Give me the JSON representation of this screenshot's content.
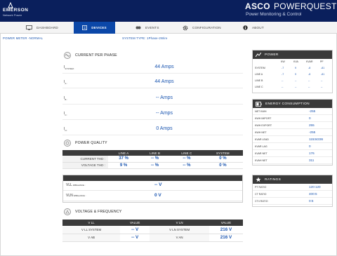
{
  "header": {
    "logo": "EMERSON",
    "logo_sub": "Network Power",
    "brand_a": "ASCO",
    "brand_b": "POWERQUEST",
    "brand_sub": "Power Monitoring & Control"
  },
  "nav": {
    "items": [
      {
        "label": "DASHBOARD",
        "icon": "monitor-icon"
      },
      {
        "label": "DEVICES",
        "icon": "device-icon"
      },
      {
        "label": "EVENTS",
        "icon": "events-icon"
      },
      {
        "label": "CONFIGURATION",
        "icon": "gear-icon"
      },
      {
        "label": "ABOUT",
        "icon": "info-icon"
      }
    ]
  },
  "status": {
    "meter": "POWER METER -NORMAL",
    "system_type": "SYSTEM TYPE: 1Phase-2Wire"
  },
  "current_per_phase": {
    "title": "CURRENT PER PHASE",
    "rows": [
      {
        "label": "I",
        "sub": "SYSTEM :",
        "value": "44 Amps"
      },
      {
        "label": "I",
        "sub": "A :",
        "value": "44 Amps"
      },
      {
        "label": "I",
        "sub": "B :",
        "value": "-- Amps"
      },
      {
        "label": "I",
        "sub": "C :",
        "value": "-- Amps"
      },
      {
        "label": "I",
        "sub": "N :",
        "value": "0 Amps"
      }
    ]
  },
  "power_quality": {
    "title": "POWER QUALITY",
    "columns": [
      "",
      "LINE A",
      "LINE B",
      "LINE C",
      "SYSTEM"
    ],
    "rows": [
      {
        "label": "CURRENT THD :",
        "a": "37 %",
        "b": "-- %",
        "c": "-- %",
        "sys": "0 %"
      },
      {
        "label": "VOLTAGE THD :",
        "a": "9 %",
        "b": "-- %",
        "c": "-- %",
        "sys": "0 %"
      }
    ]
  },
  "imbalance": {
    "rows": [
      {
        "label": "VLL",
        "sub": "IMBALANCE :",
        "value": "-- V"
      },
      {
        "label": "VLN",
        "sub": "IMBALANCE :",
        "value": "0 V"
      }
    ]
  },
  "voltage_frequency": {
    "title": "VOLTAGE & FREQUENCY",
    "columns": [
      "V LL",
      "VALUE",
      "V LN",
      "VALUE"
    ],
    "rows": [
      {
        "ll": "V LL SYSTEM",
        "llv": "-- V",
        "ln": "V LN SYSTEM",
        "lnv": "216 V"
      },
      {
        "ll": "V AB",
        "llv": "-- V",
        "ln": "V AN",
        "lnv": "216 V"
      }
    ]
  },
  "power": {
    "title": "POWER",
    "columns": [
      "KW",
      "KVA",
      "KVAR",
      "PF"
    ],
    "rows": [
      {
        "label": "SYSTEM",
        "kw": "-7",
        "kva": "9",
        "kvar": "-8",
        "pf": "-81"
      },
      {
        "label": "LINE A",
        "kw": "-7",
        "kva": "9",
        "kvar": "-8",
        "pf": "-81"
      },
      {
        "label": "LINE B",
        "kw": "--",
        "kva": "--",
        "kvar": "--",
        "pf": "--"
      },
      {
        "label": "LINE C",
        "kw": "--",
        "kva": "--",
        "kvar": "--",
        "pf": "--"
      }
    ]
  },
  "energy": {
    "title": "ENERGY CONSUMPTION",
    "rows": [
      {
        "label": "NET KWH",
        "value": "-255"
      },
      {
        "label": "KWH IMPORT",
        "value": "0"
      },
      {
        "label": "KWH EXPORT",
        "value": "255"
      },
      {
        "label": "KWH NET",
        "value": "-255"
      },
      {
        "label": "KVAR LEAD",
        "value": "11534336"
      },
      {
        "label": "KVAR LAG",
        "value": "0"
      },
      {
        "label": "KVAR NET",
        "value": "176"
      },
      {
        "label": "KVAH NET",
        "value": "311"
      }
    ]
  },
  "ratings": {
    "title": "RATINGS",
    "rows": [
      {
        "label": "PT RATIO",
        "value": "120:120"
      },
      {
        "label": "CT RATIO",
        "value": "400:5"
      },
      {
        "label": "CT4 RATIO",
        "value": "0:5"
      }
    ]
  }
}
